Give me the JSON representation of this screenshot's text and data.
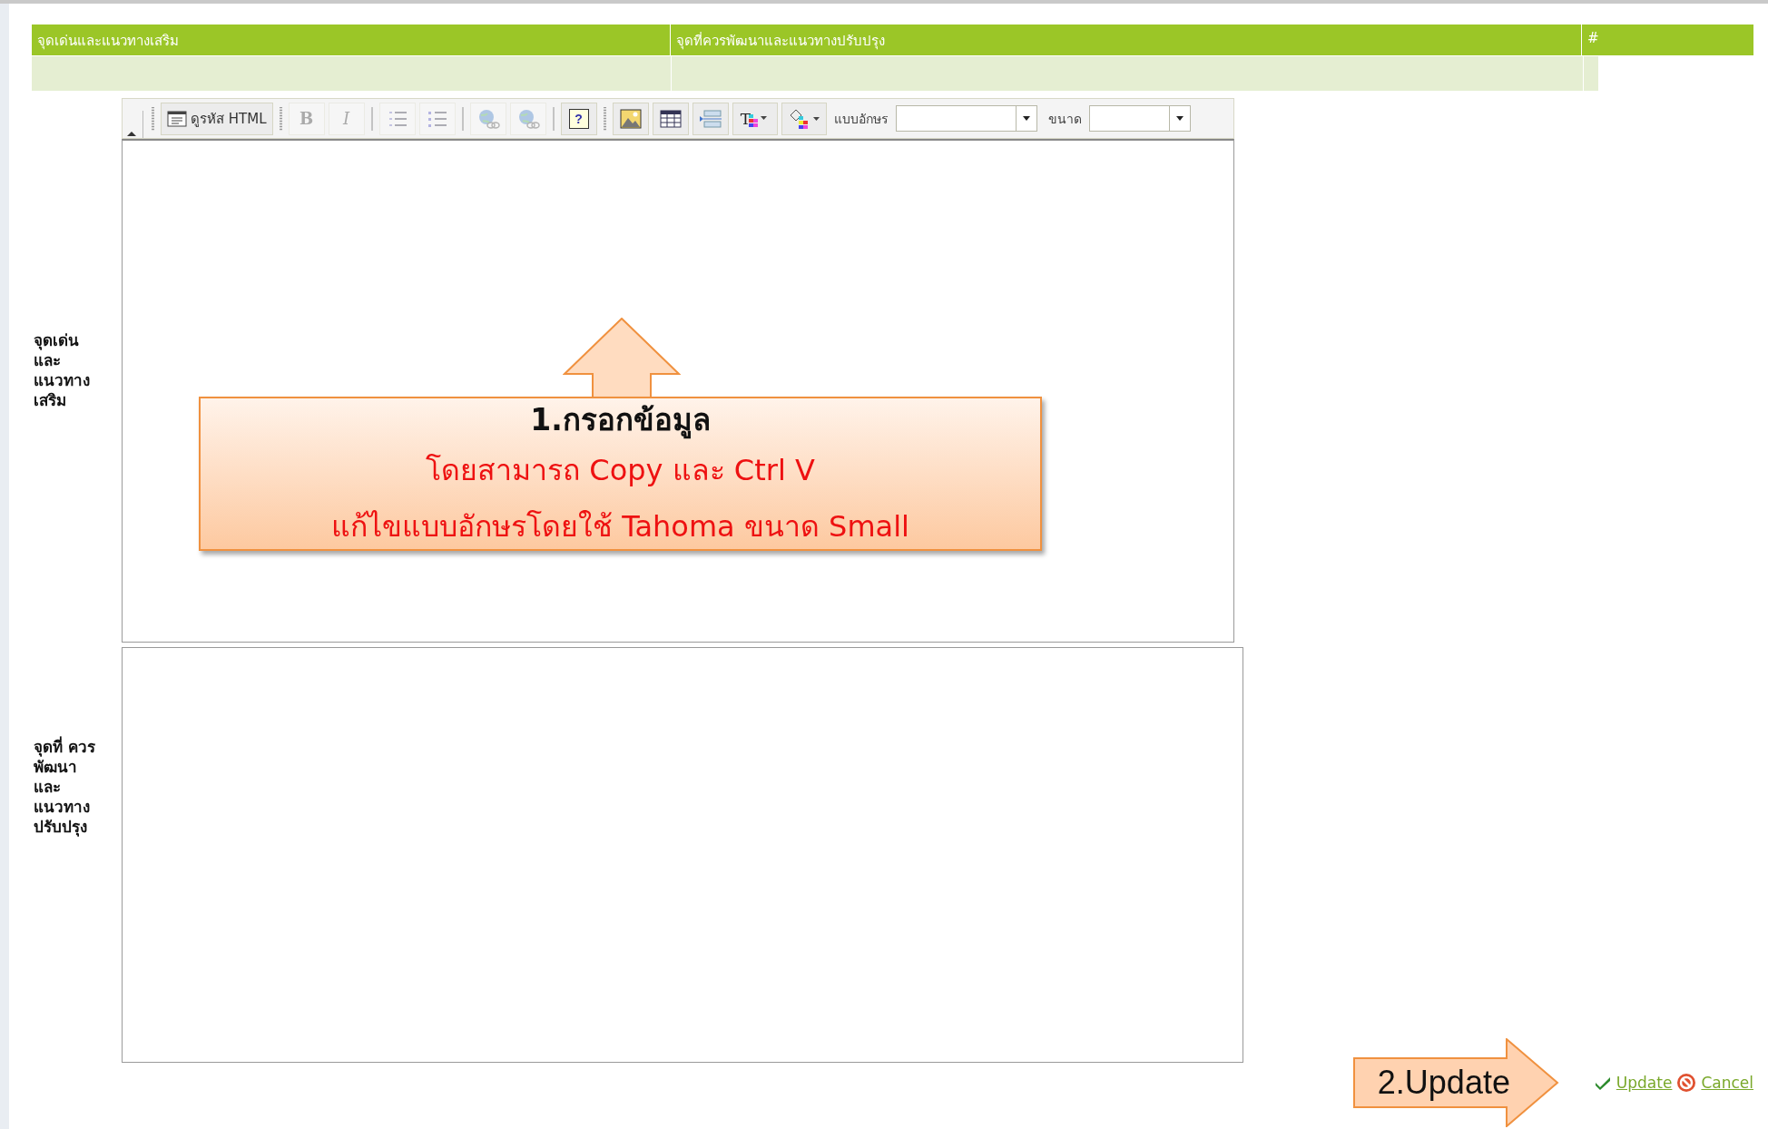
{
  "header": {
    "columns": [
      "จุดเด่นและแนวทางเสริม",
      "จุดที่ควรพัฒนาและแนวทางปรับปรุง",
      "#"
    ]
  },
  "editors": [
    {
      "label": "จุดเด่น และ แนวทาง เสริม",
      "toolbar": {
        "items": [
          {
            "kind": "collapse"
          },
          {
            "kind": "grip"
          },
          {
            "kind": "html",
            "label": "ดูรหัส HTML",
            "disabled": false
          },
          {
            "kind": "grip"
          },
          {
            "kind": "bold",
            "label": "B",
            "disabled": true
          },
          {
            "kind": "italic",
            "label": "I",
            "disabled": true
          },
          {
            "kind": "sep"
          },
          {
            "kind": "ol",
            "disabled": true
          },
          {
            "kind": "ul",
            "disabled": true
          },
          {
            "kind": "sep"
          },
          {
            "kind": "link",
            "disabled": true
          },
          {
            "kind": "unlink",
            "disabled": true
          },
          {
            "kind": "sep"
          },
          {
            "kind": "help",
            "label": "?",
            "disabled": false
          },
          {
            "kind": "grip"
          },
          {
            "kind": "image",
            "disabled": false
          },
          {
            "kind": "table",
            "disabled": false
          },
          {
            "kind": "hr",
            "disabled": false
          },
          {
            "kind": "forecolor",
            "label": "T",
            "disabled": false
          },
          {
            "kind": "backcolor",
            "disabled": false
          },
          {
            "kind": "select",
            "label": "แบบอักษร",
            "disabled": false
          },
          {
            "kind": "select",
            "label": "ขนาด",
            "disabled": false
          }
        ]
      }
    },
    {
      "label": "จุดที่ ควร พัฒนา และ แนวทาง ปรับปรุง"
    }
  ],
  "callout": {
    "title": "1.กรอกข้อมูล",
    "lines": [
      "โดยสามารถ Copy และ Ctrl V",
      "แก้ไขแบบอักษรโดยใช้ Tahoma ขนาด Small"
    ]
  },
  "update_callout": {
    "text": "2.Update"
  },
  "actions": [
    {
      "kind": "update",
      "label": "Update"
    },
    {
      "kind": "cancel",
      "label": "Cancel"
    }
  ]
}
